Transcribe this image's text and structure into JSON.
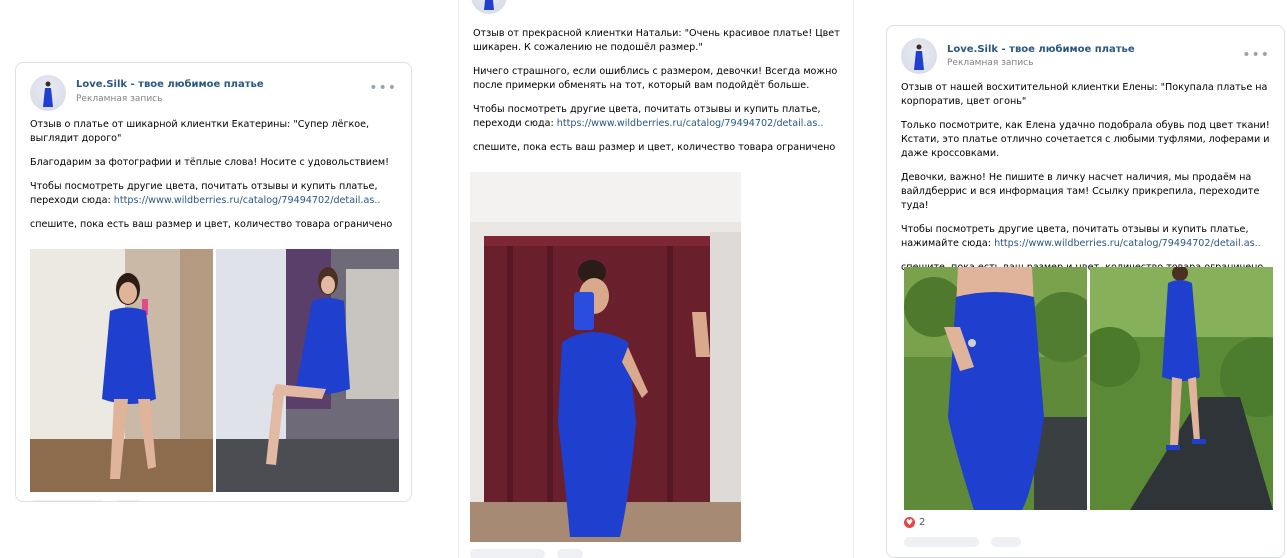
{
  "brand": {
    "link_color": "#2a5885",
    "heart_color": "#e64646",
    "dress_color": "#1f3fcf"
  },
  "posts": [
    {
      "author": "Love.Silk - твое любимое платье",
      "subtitle": "Рекламная запись",
      "more_icon": "ellipsis-icon",
      "p1": "Отзыв о платье от шикарной клиентки Екатерины: \"Супер лёгкое, выглядит дорого\"",
      "p2": "Благодарим за фотографии и тёплые слова! Носите с удовольствием!",
      "p3_prefix": "Чтобы посмотреть другие цвета, почитать отзывы и купить платье, переходи сюда: ",
      "link": "https://www.wildberries.ru/catalog/79494702/detail.as..",
      "p4": "спешите, пока есть ваш размер и цвет, количество товара ограничено"
    },
    {
      "p1": "Отзыв от прекрасной клиентки Натальи: \"Очень красивое платье! Цвет шикарен. К сожалению не подошёл размер.\"",
      "p2": "Ничего страшного, если ошиблись с размером, девочки! Всегда можно после примерки обменять на тот, который вам подойдёт больше.",
      "p3_prefix": "Чтобы посмотреть другие цвета, почитать отзывы и купить платье, переходи сюда: ",
      "link": "https://www.wildberries.ru/catalog/79494702/detail.as..",
      "p4": "спешите, пока есть ваш размер и цвет, количество товара ограничено"
    },
    {
      "author": "Love.Silk - твое любимое платье",
      "subtitle": "Рекламная запись",
      "more_icon": "ellipsis-icon",
      "p1": "Отзыв от нашей восхитительной клиентки Елены: \"Покупала платье на корпоратив, цвет огонь\"",
      "p2": "Только посмотрите, как Елена удачно подобрала обувь под цвет ткани! Кстати, это платье отлично сочетается с любыми туфлями, лоферами и даже кроссовками.",
      "p3": "Девочки, важно! Не пишите в личку насчет наличия, мы продаём на вайлдберрис и вся информация там! Ссылку прикрепила, переходите туда!",
      "p4_prefix": "Чтобы посмотреть другие цвета, почитать отзывы и купить платье, нажимайте сюда: ",
      "link": "https://www.wildberries.ru/catalog/79494702/detail.as..",
      "p5": "спешите, пока есть ваш размер и цвет, количество товара ограничено",
      "likes": "2"
    }
  ]
}
